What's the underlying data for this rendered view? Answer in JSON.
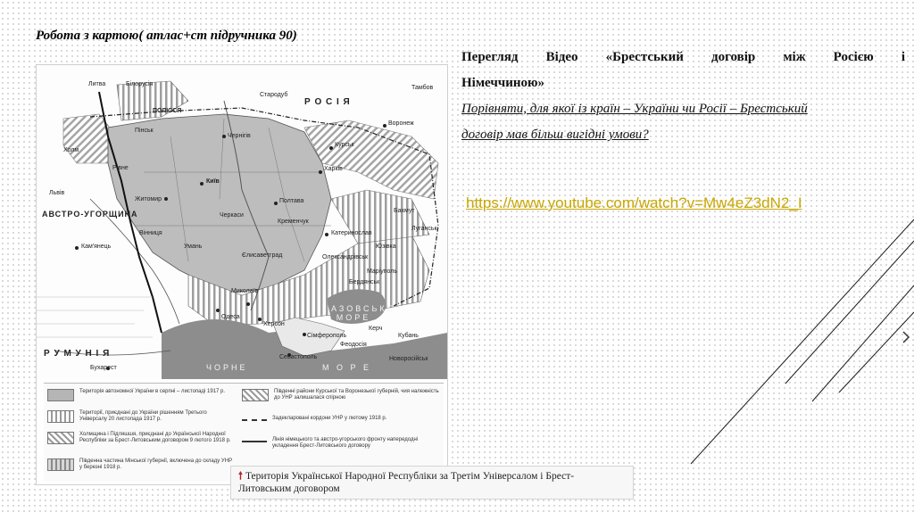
{
  "slide": {
    "title": "Робота з картою( атлас+ст підручника 90)",
    "heading_line1": "Перегляд Відео «Брестський договір між Росією і",
    "heading_line2": "Німеччиною»",
    "question_line1": "Порівняти, для якої із країн – України чи Росії – Брестський",
    "question_line2": "договір мав більш вигідні умови?",
    "link": "https://www.youtube.com/watch?v=Mw4eZ3dN2_I"
  },
  "map": {
    "labels": {
      "lytva": "Литва",
      "bilorusia": "Білорусія",
      "rosia": "Р О С І Я",
      "polissia": "ПОЛІССЯ",
      "avstro": "АВСТРО-УГОРЩИНА",
      "rumunia": "Р У М У Н І Я",
      "azov": "АЗОВСЬКЕ МОРЕ",
      "chorne": "ЧОРНЕ",
      "more": "М О Р Е",
      "kyiv": "Київ",
      "poltava": "Полтава",
      "kharkiv": "Харків",
      "kursk": "Курськ",
      "voronezh": "Воронеж",
      "odesa": "Одеса",
      "mykolaiv": "Миколаїв",
      "kherson": "Херсон",
      "sevastopol": "Севастополь",
      "simferopol": "Сімферополь",
      "katerynoslav": "Катеринослав",
      "chernihiv": "Чернігів",
      "zhytomyr": "Житомир",
      "lviv": "Львів",
      "kamianets": "Кам'янець",
      "bukharest": "Бухарест",
      "kremenchuk": "Кременчук",
      "kuban": "Кубань",
      "novorosiisk": "Новоросійськ",
      "tambov": "Тамбов",
      "starodub": "Стародуб",
      "kholm": "Холм",
      "pinsk": "Пінськ",
      "rivne": "Рівне",
      "vinnytsia": "Вінниця",
      "uman": "Умань",
      "yelysavethrad": "Єлисаветград",
      "oleksandrivsk": "Олександрівськ",
      "mariupol": "Маріуполь",
      "berdiansk": "Бердянськ",
      "bakhmut": "Бахмут",
      "yuzivka": "Юзівка",
      "luhansk": "Луганськ",
      "kerch": "Керч",
      "feodosia": "Феодосія",
      "cherkasy": "Черкаси",
      "poltavska": "Полтава"
    },
    "legend": {
      "item1": "Територія автономної України в серпні – листопаді 1917 р.",
      "item2": "Території, приєднані до України рішенням Третього Універсалу 20 листопада 1917 р.",
      "item3": "Холмщина і Підляшшя, приєднані до Української Народної Республіки за Брест-Литовським договором 9 лютого 1918 р.",
      "item4": "Південна частина Мінської губернії, включена до складу УНР у березні 1918 р.",
      "item5": "Південні райони Курської та Воронезької губерній, чия належність до УНР залишалася спірною",
      "item6": "Задекларовані кордони УНР у лютому 1918 р.",
      "item7": "Лінія німецького та австро-угорського фронту напередодні укладення Брест-Литовського договору"
    },
    "caption": "Територія Української Народної Республіки за Третім Універсалом і Брест-Литовським договором"
  },
  "colors": {
    "background": "#ffffff",
    "dot_pattern": "#cfcfcf",
    "link": "#c8a700",
    "caption_arrow": "#b22222",
    "deco_lines": "#1a1a1a"
  },
  "icons": {
    "caption_arrow": "arrow-up-icon",
    "nav_arrow": "chevron-right-icon"
  }
}
